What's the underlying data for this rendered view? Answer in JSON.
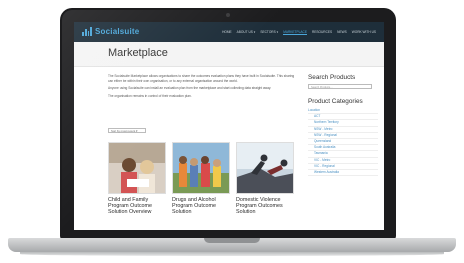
{
  "site": {
    "logo_text": "Socialsuite",
    "menu": [
      {
        "label": "HOME",
        "active": false
      },
      {
        "label": "ABOUT US ▾",
        "active": false
      },
      {
        "label": "SECTORS ▾",
        "active": false
      },
      {
        "label": "MARKETPLACE",
        "active": true
      },
      {
        "label": "RESOURCES",
        "active": false
      },
      {
        "label": "NEWS",
        "active": false
      },
      {
        "label": "WORK WITH US",
        "active": false
      }
    ]
  },
  "page": {
    "title": "Marketplace",
    "paragraphs": [
      "The Socialsuite Marketplace allows organisations to share the outcomes evaluation plans they have built in Socialsuite. This sharing can either be within their own organisation, or to any external organisation around the world.",
      "Anyone using Socialsuite can install an evaluation plan from the marketplace and start collecting data straight away.",
      "The organisation remains in control of their evaluation plan."
    ],
    "sort_select": "Sort by most recent ▾"
  },
  "cards": [
    {
      "title": "Child and Family Program Outcome Solution Overview",
      "image": "photo-girls-reading"
    },
    {
      "title": "Drugs and Alcohol Program Outcome Solution",
      "image": "photo-group-outdoors"
    },
    {
      "title": "Domestic Violence Program Outcomes Solution",
      "image": "photo-helping-hand"
    }
  ],
  "sidebar": {
    "search_heading": "Search Products",
    "search_placeholder": "Search Products…",
    "categories_heading": "Product Categories",
    "categories": [
      {
        "label": "Location",
        "top": true
      },
      {
        "label": "ACT",
        "top": false
      },
      {
        "label": "Northern Territory",
        "top": false
      },
      {
        "label": "NSW - Metro",
        "top": false
      },
      {
        "label": "NSW - Regional",
        "top": false
      },
      {
        "label": "Queensland",
        "top": false
      },
      {
        "label": "South Australia",
        "top": false
      },
      {
        "label": "Tasmania",
        "top": false
      },
      {
        "label": "VIC - Metro",
        "top": false
      },
      {
        "label": "VIC - Regional",
        "top": false
      },
      {
        "label": "Western Australia",
        "top": false
      }
    ]
  },
  "colors": {
    "nav_bg": "#1e2e3a",
    "brand": "#4aa6d9",
    "link": "#4a90c2"
  }
}
